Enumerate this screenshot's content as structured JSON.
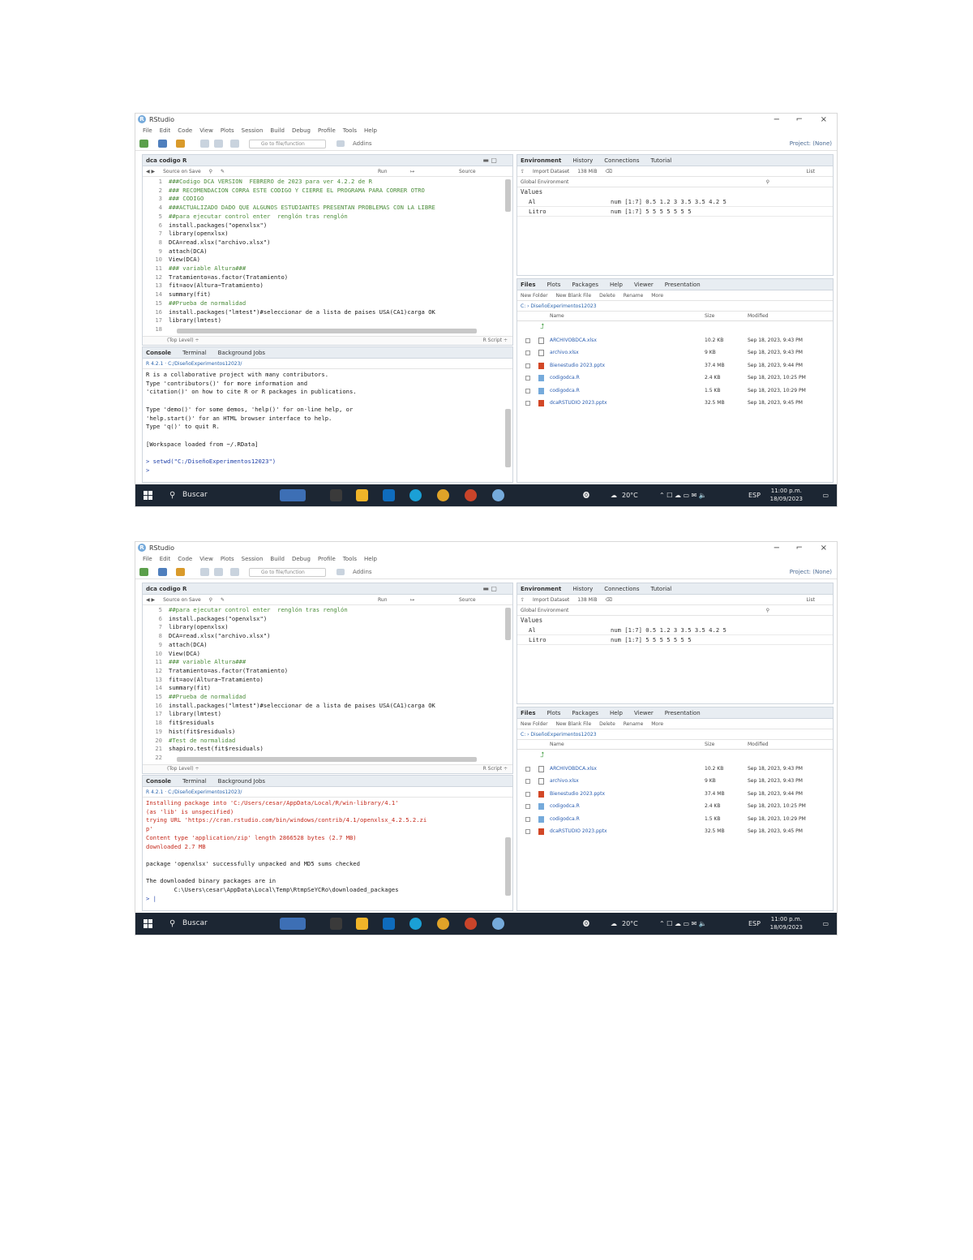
{
  "shot1": {
    "app_title": "RStudio",
    "menu": [
      "File",
      "Edit",
      "Code",
      "View",
      "Plots",
      "Session",
      "Build",
      "Debug",
      "Profile",
      "Tools",
      "Help"
    ],
    "toolbar": {
      "goto": "Go to file/function",
      "addins": "Addins",
      "project": "Project: (None)"
    },
    "editor": {
      "tab": "dca codigo R",
      "source_on_save": "Source on Save",
      "run": "Run",
      "source": "Source",
      "lines": [
        {
          "n": "1",
          "t": "###Codigo DCA VERSION  FEBRERO de 2023 para ver 4.2.2 de R",
          "c": "com"
        },
        {
          "n": "2",
          "t": "### RECOMENDACION CORRA ESTE CODIGO Y CIERRE EL PROGRAMA PARA CORRER OTRO",
          "c": "com"
        },
        {
          "n": "3",
          "t": "### CODIGO",
          "c": "com"
        },
        {
          "n": "4",
          "t": "###ACTUALIZADO DADO QUE ALGUNOS ESTUDIANTES PRESENTAN PROBLEMAS CON LA LIBRE",
          "c": "com"
        },
        {
          "n": "5",
          "t": "##para ejecutar control enter  renglón tras renglón",
          "c": "com"
        },
        {
          "n": "6",
          "t": "install.packages(\"openxlsx\")",
          "c": "fn"
        },
        {
          "n": "7",
          "t": "library(openxlsx)",
          "c": "fn"
        },
        {
          "n": "8",
          "t": "DCA=read.xlsx(\"archivo.xlsx\")",
          "c": "fn"
        },
        {
          "n": "9",
          "t": "attach(DCA)",
          "c": "fn"
        },
        {
          "n": "10",
          "t": "View(DCA)",
          "c": "fn"
        },
        {
          "n": "11",
          "t": "### variable Altura###",
          "c": "com"
        },
        {
          "n": "12",
          "t": "Tratamiento=as.factor(Tratamiento)",
          "c": "fn"
        },
        {
          "n": "13",
          "t": "fit=aov(Altura~Tratamiento)",
          "c": "fn"
        },
        {
          "n": "14",
          "t": "summary(fit)",
          "c": "fn"
        },
        {
          "n": "15",
          "t": "##Prueba de normalidad",
          "c": "com"
        },
        {
          "n": "16",
          "t": "install.packages(\"lmtest\")#seleccionar de a lista de paises USA(CA1)carga OK",
          "c": "fn"
        },
        {
          "n": "17",
          "t": "library(lmtest)",
          "c": "fn"
        },
        {
          "n": "18",
          "t": "",
          "c": "fn"
        }
      ],
      "status_left": "(Top Level) ÷",
      "status_right": "R Script ÷"
    },
    "console": {
      "tabs": [
        "Console",
        "Terminal",
        "Background Jobs"
      ],
      "path": "R 4.2.1 · C:/DiseñoExperimentos12023/",
      "lines": [
        {
          "t": "R is a collaborative project with many contributors.",
          "c": "fn"
        },
        {
          "t": "Type 'contributors()' for more information and",
          "c": "fn"
        },
        {
          "t": "'citation()' on how to cite R or R packages in publications.",
          "c": "fn"
        },
        {
          "t": "",
          "c": "fn"
        },
        {
          "t": "Type 'demo()' for some demos, 'help()' for on-line help, or",
          "c": "fn"
        },
        {
          "t": "'help.start()' for an HTML browser interface to help.",
          "c": "fn"
        },
        {
          "t": "Type 'q()' to quit R.",
          "c": "fn"
        },
        {
          "t": "",
          "c": "fn"
        },
        {
          "t": "[Workspace loaded from ~/.RData]",
          "c": "fn"
        },
        {
          "t": "",
          "c": "fn"
        },
        {
          "t": "> setwd(\"C:/DiseñoExperimentos12023\")",
          "c": "blue"
        },
        {
          "t": ">",
          "c": "blue"
        }
      ]
    },
    "env": {
      "tabs": [
        "Environment",
        "History",
        "Connections",
        "Tutorial"
      ],
      "import": "Import Dataset",
      "mem": "138 MiB",
      "list": "List",
      "global": "Global Environment",
      "values_label": "Values",
      "rows": [
        {
          "k": "Al",
          "v": "num [1:7] 0.5 1.2 3 3.5 3.5 4.2 5"
        },
        {
          "k": "Litro",
          "v": "num [1:7] 5 5 5 5 5 5 5"
        }
      ]
    },
    "files": {
      "tabs": [
        "Files",
        "Plots",
        "Packages",
        "Help",
        "Viewer",
        "Presentation"
      ],
      "new_folder": "New Folder",
      "new_blank": "New Blank File",
      "delete": "Delete",
      "rename": "Rename",
      "more": "More",
      "path": "C: › DiseñoExperimentos12023",
      "col_name": "Name",
      "col_size": "Size",
      "col_mod": "Modified",
      "rows": [
        {
          "name": "ARCHIVOBDCA.xlsx",
          "size": "10.2 KB",
          "mod": "Sep 18, 2023, 9:43 PM",
          "icon": "file"
        },
        {
          "name": "archivo.xlsx",
          "size": "9 KB",
          "mod": "Sep 18, 2023, 9:43 PM",
          "icon": "file"
        },
        {
          "name": "Bienestudio 2023.pptx",
          "size": "37.4 MB",
          "mod": "Sep 18, 2023, 9:44 PM",
          "icon": "ppt"
        },
        {
          "name": "codigodca.R",
          "size": "2.4 KB",
          "mod": "Sep 18, 2023, 10:25 PM",
          "icon": "r"
        },
        {
          "name": "codigodca.R",
          "size": "1.5 KB",
          "mod": "Sep 18, 2023, 10:29 PM",
          "icon": "r"
        },
        {
          "name": "dcaRSTUDIO 2023.pptx",
          "size": "32.5 MB",
          "mod": "Sep 18, 2023, 9:45 PM",
          "icon": "ppt"
        }
      ]
    },
    "taskbar": {
      "search": "Buscar",
      "weather": "20°C",
      "lang": "ESP",
      "time": "11:00 p.m.",
      "date": "18/09/2023"
    }
  },
  "shot2": {
    "app_title": "RStudio",
    "menu": [
      "File",
      "Edit",
      "Code",
      "View",
      "Plots",
      "Session",
      "Build",
      "Debug",
      "Profile",
      "Tools",
      "Help"
    ],
    "toolbar": {
      "goto": "Go to file/function",
      "addins": "Addins",
      "project": "Project: (None)"
    },
    "editor": {
      "tab": "dca codigo R",
      "source_on_save": "Source on Save",
      "run": "Run",
      "source": "Source",
      "lines": [
        {
          "n": "5",
          "t": "##para ejecutar control enter  renglón tras renglón",
          "c": "com"
        },
        {
          "n": "6",
          "t": "install.packages(\"openxlsx\")",
          "c": "fn"
        },
        {
          "n": "7",
          "t": "library(openxlsx)",
          "c": "fn"
        },
        {
          "n": "8",
          "t": "DCA=read.xlsx(\"archivo.xlsx\")",
          "c": "fn"
        },
        {
          "n": "9",
          "t": "attach(DCA)",
          "c": "fn"
        },
        {
          "n": "10",
          "t": "View(DCA)",
          "c": "fn"
        },
        {
          "n": "11",
          "t": "### variable Altura###",
          "c": "com"
        },
        {
          "n": "12",
          "t": "Tratamiento=as.factor(Tratamiento)",
          "c": "fn"
        },
        {
          "n": "13",
          "t": "fit=aov(Altura~Tratamiento)",
          "c": "fn"
        },
        {
          "n": "14",
          "t": "summary(fit)",
          "c": "fn"
        },
        {
          "n": "15",
          "t": "##Prueba de normalidad",
          "c": "com"
        },
        {
          "n": "16",
          "t": "install.packages(\"lmtest\")#seleccionar de a lista de paises USA(CA1)carga OK",
          "c": "fn"
        },
        {
          "n": "17",
          "t": "library(lmtest)",
          "c": "fn"
        },
        {
          "n": "18",
          "t": "fit$residuals",
          "c": "fn"
        },
        {
          "n": "19",
          "t": "hist(fit$residuals)",
          "c": "fn"
        },
        {
          "n": "20",
          "t": "#Test de normalidad",
          "c": "com"
        },
        {
          "n": "21",
          "t": "shapiro.test(fit$residuals)",
          "c": "fn"
        },
        {
          "n": "22",
          "t": "",
          "c": "fn"
        }
      ],
      "status_left": "(Top Level) ÷",
      "status_right": "R Script ÷"
    },
    "console": {
      "tabs": [
        "Console",
        "Terminal",
        "Background Jobs"
      ],
      "path": "R 4.2.1 · C:/DiseñoExperimentos12023/",
      "lines": [
        {
          "t": "Installing package into 'C:/Users/cesar/AppData/Local/R/win-library/4.1'",
          "c": "red"
        },
        {
          "t": "(as 'lib' is unspecified)",
          "c": "red"
        },
        {
          "t": "trying URL 'https://cran.rstudio.com/bin/windows/contrib/4.1/openxlsx_4.2.5.2.zi",
          "c": "red"
        },
        {
          "t": "p'",
          "c": "red"
        },
        {
          "t": "Content type 'application/zip' length 2866528 bytes (2.7 MB)",
          "c": "red"
        },
        {
          "t": "downloaded 2.7 MB",
          "c": "red"
        },
        {
          "t": "",
          "c": "fn"
        },
        {
          "t": "package 'openxlsx' successfully unpacked and MD5 sums checked",
          "c": "fn"
        },
        {
          "t": "",
          "c": "fn"
        },
        {
          "t": "The downloaded binary packages are in",
          "c": "fn"
        },
        {
          "t": "        C:\\Users\\cesar\\AppData\\Local\\Temp\\RtmpSeYCRo\\downloaded_packages",
          "c": "fn"
        },
        {
          "t": "> |",
          "c": "blue"
        }
      ]
    },
    "env": {
      "tabs": [
        "Environment",
        "History",
        "Connections",
        "Tutorial"
      ],
      "import": "Import Dataset",
      "mem": "138 MiB",
      "list": "List",
      "global": "Global Environment",
      "values_label": "Values",
      "rows": [
        {
          "k": "Al",
          "v": "num [1:7] 0.5 1.2 3 3.5 3.5 4.2 5"
        },
        {
          "k": "Litro",
          "v": "num [1:7] 5 5 5 5 5 5 5"
        }
      ]
    },
    "files": {
      "tabs": [
        "Files",
        "Plots",
        "Packages",
        "Help",
        "Viewer",
        "Presentation"
      ],
      "new_folder": "New Folder",
      "new_blank": "New Blank File",
      "delete": "Delete",
      "rename": "Rename",
      "more": "More",
      "path": "C: › DiseñoExperimentos12023",
      "col_name": "Name",
      "col_size": "Size",
      "col_mod": "Modified",
      "rows": [
        {
          "name": "ARCHIVOBDCA.xlsx",
          "size": "10.2 KB",
          "mod": "Sep 18, 2023, 9:43 PM",
          "icon": "file"
        },
        {
          "name": "archivo.xlsx",
          "size": "9 KB",
          "mod": "Sep 18, 2023, 9:43 PM",
          "icon": "file"
        },
        {
          "name": "Bienestudio 2023.pptx",
          "size": "37.4 MB",
          "mod": "Sep 18, 2023, 9:44 PM",
          "icon": "ppt"
        },
        {
          "name": "codigodca.R",
          "size": "2.4 KB",
          "mod": "Sep 18, 2023, 10:25 PM",
          "icon": "r"
        },
        {
          "name": "codigodca.R",
          "size": "1.5 KB",
          "mod": "Sep 18, 2023, 10:29 PM",
          "icon": "r"
        },
        {
          "name": "dcaRSTUDIO 2023.pptx",
          "size": "32.5 MB",
          "mod": "Sep 18, 2023, 9:45 PM",
          "icon": "ppt"
        }
      ]
    },
    "taskbar": {
      "search": "Buscar",
      "weather": "20°C",
      "lang": "ESP",
      "time": "11:00 p.m.",
      "date": "18/09/2023"
    }
  }
}
